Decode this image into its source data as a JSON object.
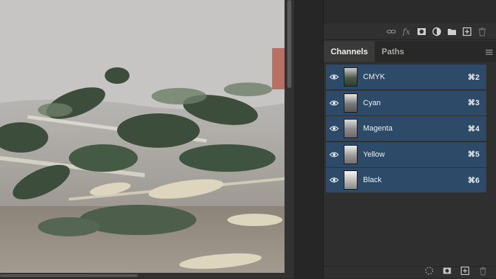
{
  "panel": {
    "tabs": [
      {
        "label": "Channels",
        "active": true
      },
      {
        "label": "Paths",
        "active": false
      }
    ],
    "layer_tools": [
      "link-icon",
      "fx-icon",
      "mask-icon",
      "adjustment-icon",
      "folder-icon",
      "new-layer-icon",
      "trash-icon"
    ],
    "fx_label": "fx",
    "channels": [
      {
        "label": "CMYK",
        "shortcut": "⌘2",
        "icon": "eye-icon"
      },
      {
        "label": "Cyan",
        "shortcut": "⌘3",
        "icon": "eye-icon"
      },
      {
        "label": "Magenta",
        "shortcut": "⌘4",
        "icon": "eye-icon"
      },
      {
        "label": "Yellow",
        "shortcut": "⌘5",
        "icon": "eye-icon"
      },
      {
        "label": "Black",
        "shortcut": "⌘6",
        "icon": "eye-icon"
      }
    ],
    "footer_tools": [
      "load-selection-icon",
      "save-mask-icon",
      "new-channel-icon",
      "delete-channel-icon"
    ]
  },
  "colors": {
    "selected_row": "#2d4a68",
    "panel_bg": "#2f2f2f",
    "app_bg": "#282828"
  }
}
